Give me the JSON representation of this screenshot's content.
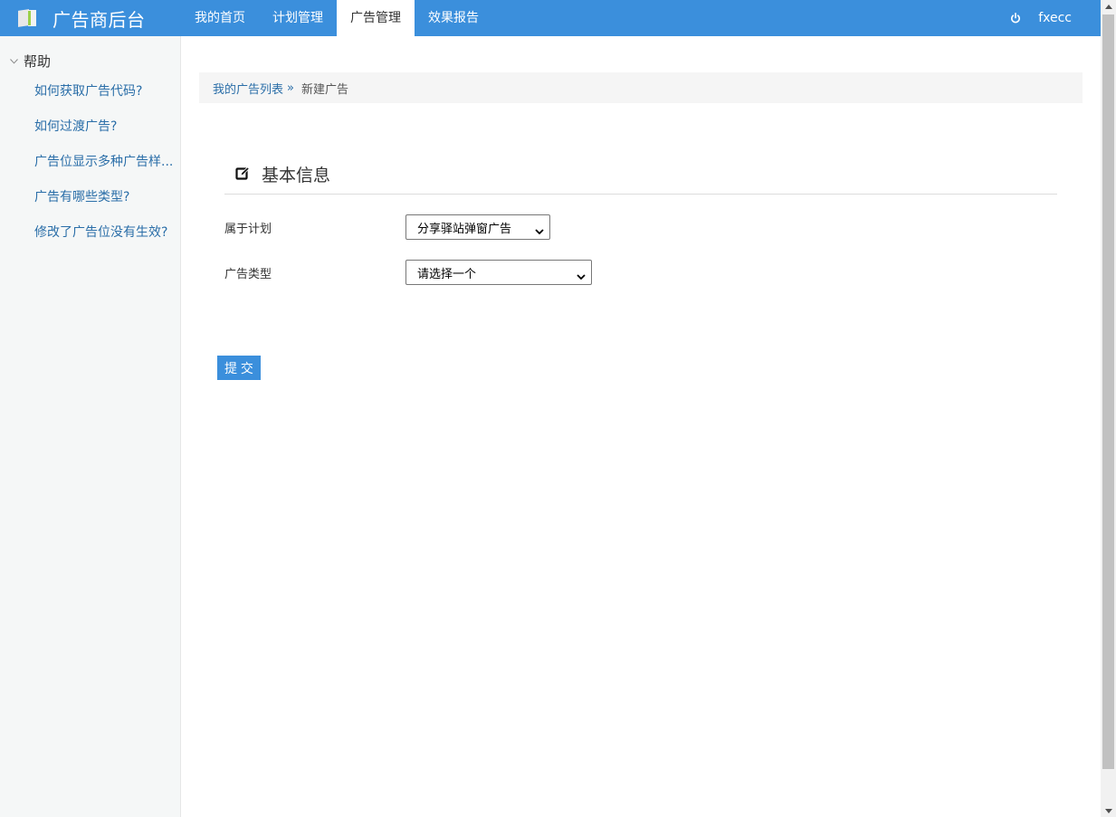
{
  "app": {
    "title": "广告商后台"
  },
  "nav": {
    "items": [
      {
        "label": "我的首页"
      },
      {
        "label": "计划管理"
      },
      {
        "label": "广告管理"
      },
      {
        "label": "效果报告"
      }
    ],
    "active": "广告管理"
  },
  "user": {
    "name": "fxecc"
  },
  "sidebar": {
    "help_title": "帮助",
    "items": [
      {
        "label": "如何获取广告代码?"
      },
      {
        "label": "如何过渡广告?"
      },
      {
        "label": "广告位显示多种广告样..."
      },
      {
        "label": "广告有哪些类型?"
      },
      {
        "label": "修改了广告位没有生效?"
      }
    ]
  },
  "breadcrumb": {
    "link": "我的广告列表",
    "separator": "»",
    "current": "新建广告"
  },
  "section": {
    "title": "基本信息"
  },
  "form": {
    "plan": {
      "label": "属于计划",
      "value": "分享驿站弹窗广告"
    },
    "ad_type": {
      "label": "广告类型",
      "value": "请选择一个"
    },
    "submit": "提 交"
  },
  "colors": {
    "accent": "#3b8fdc",
    "link": "#2a6ea8",
    "sidebar_bg": "#f5f7f7"
  }
}
